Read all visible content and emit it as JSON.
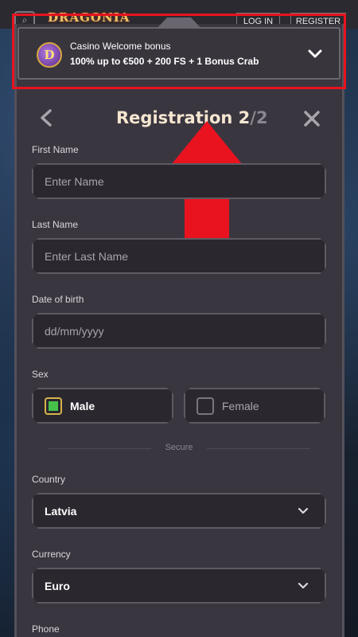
{
  "header": {
    "logo_text": "DRAGONIA",
    "login_label": "LOG IN",
    "register_label": "REGISTER"
  },
  "bonus": {
    "title": "Casino Welcome bonus",
    "description": "100% up to €500 + 200 FS + 1 Bonus Crab",
    "icon_letter": "D"
  },
  "registration": {
    "title": "Registration",
    "step_current": "2",
    "step_separator": "/",
    "step_total": "2"
  },
  "form": {
    "first_name": {
      "label": "First Name",
      "placeholder": "Enter Name"
    },
    "last_name": {
      "label": "Last Name",
      "placeholder": "Enter Last Name"
    },
    "dob": {
      "label": "Date of birth",
      "placeholder": "dd/mm/yyyy"
    },
    "sex": {
      "label": "Sex",
      "options": [
        "Male",
        "Female"
      ],
      "selected": "Male"
    },
    "secure_divider": "Secure",
    "country": {
      "label": "Country",
      "value": "Latvia"
    },
    "currency": {
      "label": "Currency",
      "value": "Euro"
    },
    "phone": {
      "label": "Phone"
    }
  },
  "colors": {
    "highlight": "#e8131f",
    "arrow": "#e8131f",
    "panel": "#3a3640",
    "field": "#2a272e",
    "selected_radio": "#46c24a"
  }
}
